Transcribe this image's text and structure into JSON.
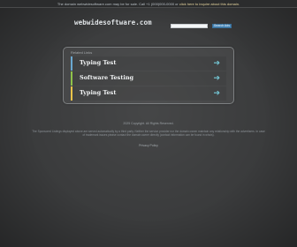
{
  "topbar": {
    "text": "The domain webwidesoftware.com may be for sale. Call +1 (000)000-0000 or",
    "link_text": "click here to inquire about this domain."
  },
  "header": {
    "logo": "webwidesoftware.com",
    "search_placeholder": "",
    "search_button": "Search Ads"
  },
  "panel": {
    "title": "Related Links",
    "items": [
      {
        "label": "Typing Test",
        "accent": "#6aa8d0"
      },
      {
        "label": "Software Testing",
        "accent": "#8fc24a"
      },
      {
        "label": "Typing Test",
        "accent": "#e8c34a"
      }
    ],
    "arrow_icon": "➔"
  },
  "footer": {
    "copyright": "2025 Copyright. All Rights Reserved.",
    "disclaimer": "The Sponsored Listings displayed above are served automatically by a third party. Neither the service provider nor the domain owner maintain any relationship with the advertisers. In case of trademark issues please contact the domain owner directly (contact information can be found in whois).",
    "privacy": "Privacy Policy"
  }
}
